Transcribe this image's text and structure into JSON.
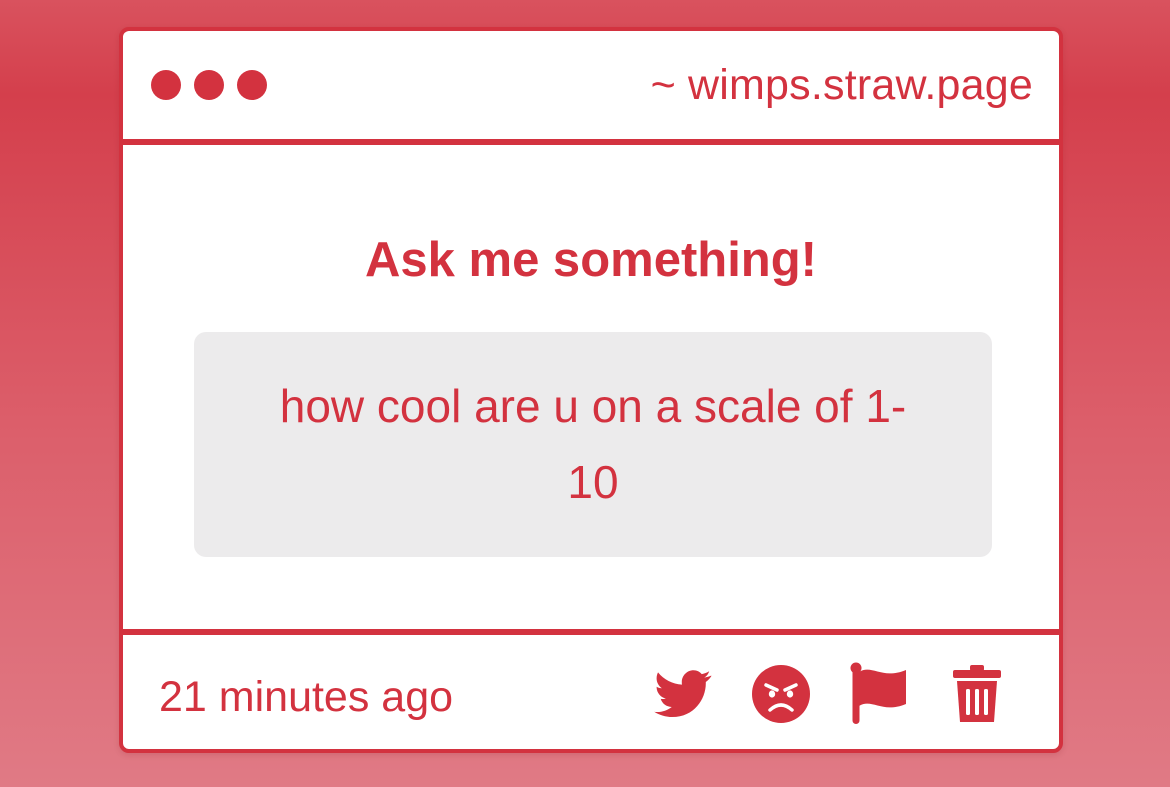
{
  "window": {
    "url": "~ wimps.straw.page",
    "controls": [
      "dot",
      "dot",
      "dot"
    ]
  },
  "main": {
    "heading": "Ask me something!",
    "question_line_1": "how cool are u on a scale of 1-",
    "question_line_2": "10"
  },
  "footer": {
    "timestamp": "21 minutes ago",
    "actions": [
      {
        "icon": "twitter-icon",
        "action": "share-to-twitter"
      },
      {
        "icon": "angry-face-icon",
        "action": "block"
      },
      {
        "icon": "flag-icon",
        "action": "report"
      },
      {
        "icon": "trash-icon",
        "action": "delete"
      }
    ]
  },
  "colors": {
    "accent": "#d3323f",
    "box_background": "#ecebec",
    "card_background": "#ffffff"
  }
}
